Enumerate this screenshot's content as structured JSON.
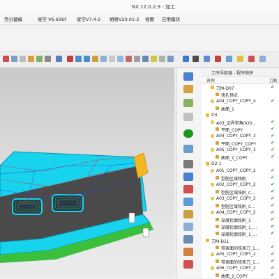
{
  "window": {
    "title": "NX 12.0.2.9 - 加工"
  },
  "menubar": {
    "items": [
      "完分建编",
      "星空 V6.936F",
      "星空V7.4-2",
      "胡射V20.01-2",
      "视图",
      "应用模块"
    ]
  },
  "nav": {
    "title": "工序导航器 - 程序顺序",
    "col_name": "名称",
    "col_tool": "刀轨",
    "rows": [
      {
        "label": "刀M-D07",
        "type": "folder",
        "indent": 1,
        "check": true
      },
      {
        "label": "快孔预点",
        "type": "op",
        "indent": 2,
        "check": false
      },
      {
        "label": "A04_COPY_COPY_4",
        "type": "op",
        "indent": 1,
        "check": true
      },
      {
        "label": "曲面_1",
        "type": "op",
        "indent": 2,
        "check": false
      },
      {
        "label": "D4",
        "type": "folder",
        "indent": 0,
        "check": false
      },
      {
        "label": "A03_边界带角(K)0...",
        "type": "op",
        "indent": 1,
        "check": true
      },
      {
        "label": "平面_COPY",
        "type": "op",
        "indent": 2,
        "check": true
      },
      {
        "label": "A04_COPY_COPY_3",
        "type": "op",
        "indent": 1,
        "check": true
      },
      {
        "label": "平面_COPY_COPY",
        "type": "op",
        "indent": 2,
        "check": true
      },
      {
        "label": "A05_COPY_COPY_3",
        "type": "op",
        "indent": 1,
        "check": true
      },
      {
        "label": "曲面_1_COPY",
        "type": "op",
        "indent": 2,
        "check": true
      },
      {
        "label": "D2-1",
        "type": "folder",
        "indent": 0,
        "check": false
      },
      {
        "label": "A01_COPY_COPY_2",
        "type": "op",
        "indent": 1,
        "check": true
      },
      {
        "label": "型腔区域铣削",
        "type": "op",
        "indent": 2,
        "check": true
      },
      {
        "label": "A02_COPY_COPY_2",
        "type": "op",
        "indent": 1,
        "check": true
      },
      {
        "label": "型腔区域铣削_C...",
        "type": "op",
        "indent": 2,
        "check": true
      },
      {
        "label": "A03_COPY_COPY_2",
        "type": "op",
        "indent": 1,
        "check": true
      },
      {
        "label": "型腔区域铣削_C...",
        "type": "op",
        "indent": 2,
        "check": true
      },
      {
        "label": "A04_COPY_COPY_2",
        "type": "op",
        "indent": 1,
        "check": true
      },
      {
        "label": "深度轮廓铣削_1",
        "type": "op",
        "indent": 2,
        "check": true
      },
      {
        "label": "深度轮廓铣削_1_...",
        "type": "op",
        "indent": 2,
        "check": true
      },
      {
        "label": "深度轮廓铣削_1_...",
        "type": "op",
        "indent": 2,
        "check": true
      },
      {
        "label": "刀M-D11",
        "type": "folder",
        "indent": 0,
        "check": false
      },
      {
        "label": "带表面的铣表刀_1...",
        "type": "op",
        "indent": 2,
        "check": true
      },
      {
        "label": "A05_COPY_COPY_2",
        "type": "op",
        "indent": 1,
        "check": true
      },
      {
        "label": "带表面的铣表刀_1...",
        "type": "op",
        "indent": 2,
        "check": true
      },
      {
        "label": "A06_COPY_COPY_2",
        "type": "op",
        "indent": 1,
        "check": true
      },
      {
        "label": "曲面_2_COPY",
        "type": "op",
        "indent": 2,
        "check": true
      }
    ]
  },
  "colors": {
    "cyan": "#17d3ee",
    "orange": "#f5b825",
    "check": "#1a9a1a",
    "toolpath_red": "#e0303a",
    "toolpath_blue": "#2a48d8"
  }
}
